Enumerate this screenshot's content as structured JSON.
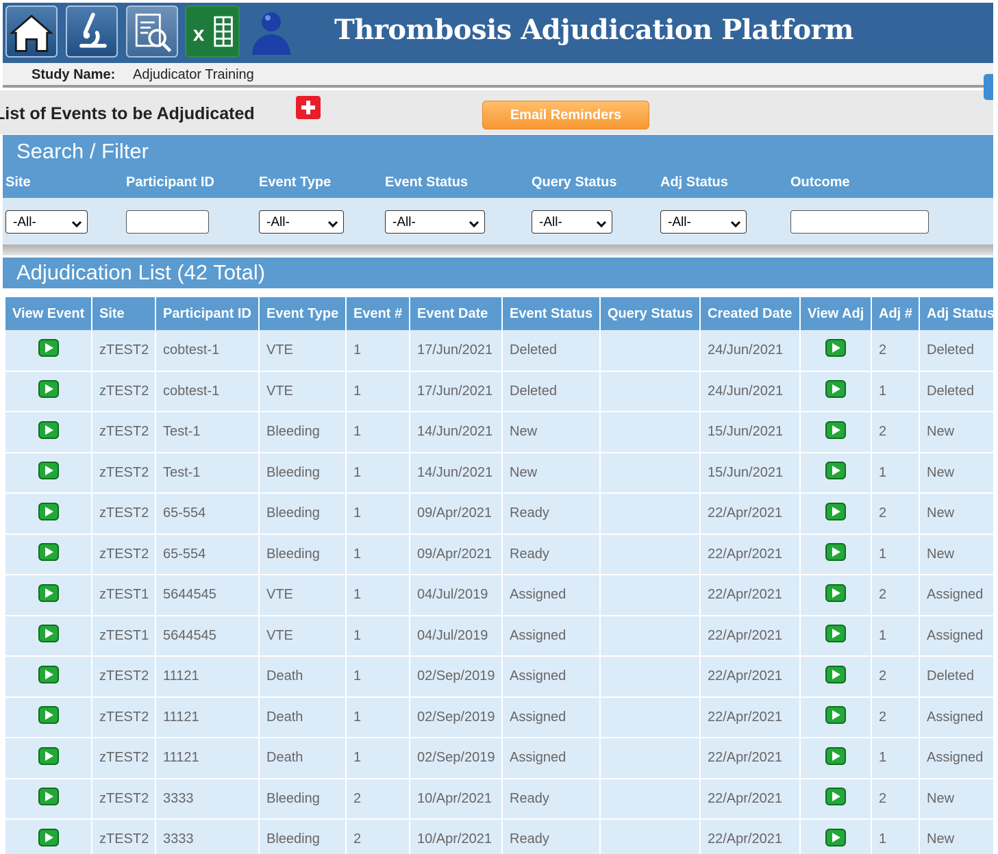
{
  "app": {
    "title": "Thrombosis Adjudication Platform",
    "toolbar_icons": [
      "home-icon",
      "microscope-icon",
      "report-search-icon",
      "excel-icon",
      "user-icon"
    ]
  },
  "study": {
    "label": "Study Name:",
    "value": "Adjudicator Training"
  },
  "list_header": {
    "title": "List of Events to be Adjudicated",
    "add_icon": "add-icon",
    "email_button": "Email Reminders"
  },
  "filter": {
    "title": "Search / Filter",
    "fields": [
      {
        "label": "Site",
        "type": "select",
        "value": "-All-"
      },
      {
        "label": "Participant ID",
        "type": "input",
        "value": ""
      },
      {
        "label": "Event Type",
        "type": "select",
        "value": "-All-"
      },
      {
        "label": "Event Status",
        "type": "select",
        "value": "-All-"
      },
      {
        "label": "Query Status",
        "type": "select",
        "value": "-All-"
      },
      {
        "label": "Adj Status",
        "type": "select",
        "value": "-All-"
      },
      {
        "label": "Outcome",
        "type": "input",
        "value": ""
      }
    ]
  },
  "adjudication_list": {
    "title": "Adjudication List (42 Total)",
    "columns": [
      "View Event",
      "Site",
      "Participant ID",
      "Event Type",
      "Event #",
      "Event Date",
      "Event Status",
      "Query Status",
      "Created Date",
      "View Adj",
      "Adj #",
      "Adj Status"
    ],
    "rows": [
      {
        "site": "zTEST2",
        "participant": "cobtest-1",
        "event_type": "VTE",
        "event_no": "1",
        "event_date": "17/Jun/2021",
        "event_status": "Deleted",
        "query_status": "",
        "created": "24/Jun/2021",
        "adj_no": "2",
        "adj_status": "Deleted"
      },
      {
        "site": "zTEST2",
        "participant": "cobtest-1",
        "event_type": "VTE",
        "event_no": "1",
        "event_date": "17/Jun/2021",
        "event_status": "Deleted",
        "query_status": "",
        "created": "24/Jun/2021",
        "adj_no": "1",
        "adj_status": "Deleted"
      },
      {
        "site": "zTEST2",
        "participant": "Test-1",
        "event_type": "Bleeding",
        "event_no": "1",
        "event_date": "14/Jun/2021",
        "event_status": "New",
        "query_status": "",
        "created": "15/Jun/2021",
        "adj_no": "2",
        "adj_status": "New"
      },
      {
        "site": "zTEST2",
        "participant": "Test-1",
        "event_type": "Bleeding",
        "event_no": "1",
        "event_date": "14/Jun/2021",
        "event_status": "New",
        "query_status": "",
        "created": "15/Jun/2021",
        "adj_no": "1",
        "adj_status": "New"
      },
      {
        "site": "zTEST2",
        "participant": "65-554",
        "event_type": "Bleeding",
        "event_no": "1",
        "event_date": "09/Apr/2021",
        "event_status": "Ready",
        "query_status": "",
        "created": "22/Apr/2021",
        "adj_no": "2",
        "adj_status": "New"
      },
      {
        "site": "zTEST2",
        "participant": "65-554",
        "event_type": "Bleeding",
        "event_no": "1",
        "event_date": "09/Apr/2021",
        "event_status": "Ready",
        "query_status": "",
        "created": "22/Apr/2021",
        "adj_no": "1",
        "adj_status": "New"
      },
      {
        "site": "zTEST1",
        "participant": "5644545",
        "event_type": "VTE",
        "event_no": "1",
        "event_date": "04/Jul/2019",
        "event_status": "Assigned",
        "query_status": "",
        "created": "22/Apr/2021",
        "adj_no": "2",
        "adj_status": "Assigned"
      },
      {
        "site": "zTEST1",
        "participant": "5644545",
        "event_type": "VTE",
        "event_no": "1",
        "event_date": "04/Jul/2019",
        "event_status": "Assigned",
        "query_status": "",
        "created": "22/Apr/2021",
        "adj_no": "1",
        "adj_status": "Assigned"
      },
      {
        "site": "zTEST2",
        "participant": "11121",
        "event_type": "Death",
        "event_no": "1",
        "event_date": "02/Sep/2019",
        "event_status": "Assigned",
        "query_status": "",
        "created": "22/Apr/2021",
        "adj_no": "2",
        "adj_status": "Deleted"
      },
      {
        "site": "zTEST2",
        "participant": "11121",
        "event_type": "Death",
        "event_no": "1",
        "event_date": "02/Sep/2019",
        "event_status": "Assigned",
        "query_status": "",
        "created": "22/Apr/2021",
        "adj_no": "2",
        "adj_status": "Assigned"
      },
      {
        "site": "zTEST2",
        "participant": "11121",
        "event_type": "Death",
        "event_no": "1",
        "event_date": "02/Sep/2019",
        "event_status": "Assigned",
        "query_status": "",
        "created": "22/Apr/2021",
        "adj_no": "1",
        "adj_status": "Assigned"
      },
      {
        "site": "zTEST2",
        "participant": "3333",
        "event_type": "Bleeding",
        "event_no": "2",
        "event_date": "10/Apr/2021",
        "event_status": "Ready",
        "query_status": "",
        "created": "22/Apr/2021",
        "adj_no": "2",
        "adj_status": "New"
      },
      {
        "site": "zTEST2",
        "participant": "3333",
        "event_type": "Bleeding",
        "event_no": "2",
        "event_date": "10/Apr/2021",
        "event_status": "Ready",
        "query_status": "",
        "created": "22/Apr/2021",
        "adj_no": "1",
        "adj_status": "New"
      }
    ],
    "row_icons": {
      "view_event": "play-icon",
      "view_adj": "play-icon"
    }
  },
  "colors": {
    "banner": "#33649a",
    "panel_header": "#5b9bd0",
    "row_bg": "#dcebf8",
    "email_button": "#f79833",
    "add_icon": "#e81e2a",
    "play_icon": "#22a838"
  }
}
